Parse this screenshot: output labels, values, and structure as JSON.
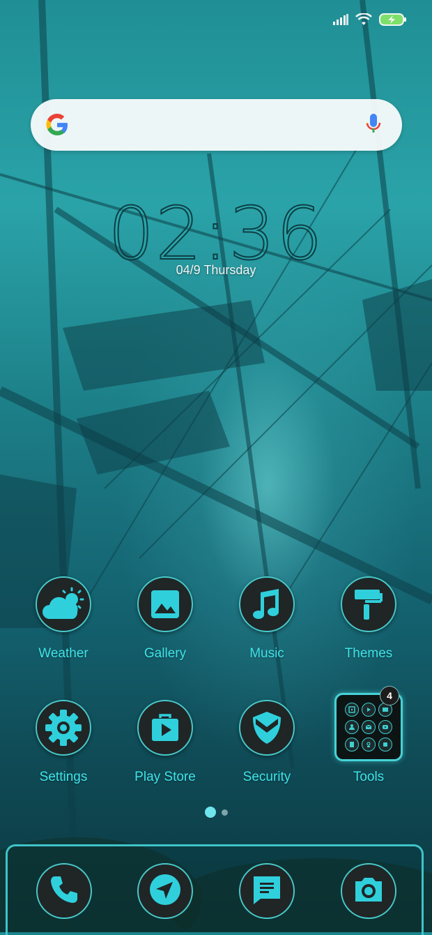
{
  "clock": {
    "time": "02:36",
    "date": "04/9 Thursday"
  },
  "apps": [
    {
      "label": "Weather",
      "icon": "weather-icon"
    },
    {
      "label": "Gallery",
      "icon": "gallery-icon"
    },
    {
      "label": "Music",
      "icon": "music-icon"
    },
    {
      "label": "Themes",
      "icon": "themes-icon"
    },
    {
      "label": "Settings",
      "icon": "settings-icon"
    },
    {
      "label": "Play Store",
      "icon": "play-store-icon"
    },
    {
      "label": "Security",
      "icon": "security-icon"
    },
    {
      "label": "Tools",
      "icon": "folder-icon",
      "badge": "4"
    }
  ],
  "dock": [
    {
      "icon": "phone-icon"
    },
    {
      "icon": "navigation-icon"
    },
    {
      "icon": "messages-icon"
    },
    {
      "icon": "camera-icon"
    }
  ],
  "colors": {
    "accent": "#3fe4e8",
    "icon_bg": "#202526",
    "icon_glyph": "#2fd0dc"
  }
}
